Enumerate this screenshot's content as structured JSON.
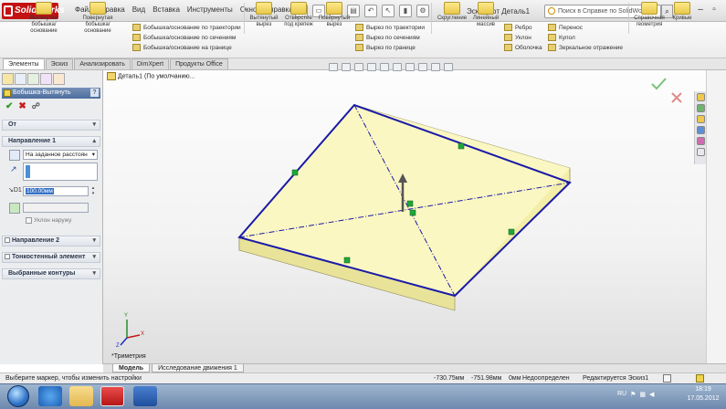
{
  "app": {
    "logo_text": "SolidWorks",
    "menu": [
      "Файл",
      "Правка",
      "Вид",
      "Вставка",
      "Инструменты",
      "Окно",
      "Справка"
    ],
    "doc_title": "Эскиз1 от Деталь1",
    "search_placeholder": "Поиск в Справке по SolidWorks"
  },
  "ribbon": {
    "large": [
      {
        "label": "Вытянутая бобышка/основание"
      },
      {
        "label": "Повернутая бобышка/основание"
      },
      {
        "label": "Вытянутый вырез"
      },
      {
        "label": "Отверстие под крепеж"
      },
      {
        "label": "Повернутый вырез"
      },
      {
        "label": "Скругление"
      },
      {
        "label": "Линейный массив"
      },
      {
        "label": "Справочная геометрия"
      },
      {
        "label": "Кривые"
      }
    ],
    "small_boss": [
      "Бобышка/основание по траектории",
      "Бобышка/основание по сечениям",
      "Бобышка/основание на границе"
    ],
    "small_cut": [
      "Вырез по траектории",
      "Вырез по сечениям",
      "Вырез по границе"
    ],
    "small_feat": [
      "Ребро",
      "Уклон",
      "Оболочка"
    ],
    "small_move": [
      "Перенос",
      "Купол",
      "Зеркальное отражение"
    ]
  },
  "tabs": [
    "Элементы",
    "Эскиз",
    "Анализировать",
    "DimXpert",
    "Продукты Office"
  ],
  "panel": {
    "feature_title": "Бобышка-Вытянуть",
    "help_icon": "?",
    "ok_symbol": "✔",
    "cancel_symbol": "✖",
    "from_label": "От",
    "direction1_label": "Направление 1",
    "end_condition": "На заданное расстоян",
    "depth_value": "100.00мм",
    "draft_outward": "Уклон наружу",
    "direction2_label": "Направление 2",
    "thin_feature_label": "Тонкостенный элемент",
    "selected_contours_label": "Выбранные контуры"
  },
  "graphics": {
    "tree_ref": "Деталь1 (По умолчанию...",
    "view_label": "*Триметрия",
    "triad": {
      "x": "X",
      "y": "Y",
      "z": "Z"
    },
    "model_fill": "#fbf7c2",
    "edge_color": "#1a1aa8"
  },
  "bottom_tabs": [
    "Модель",
    "Исследование движения 1"
  ],
  "status": {
    "hint": "Выберите маркер, чтобы изменить настройки",
    "x": "-730.75мм",
    "y": "-751.98мм",
    "z": "0мм",
    "state": "Недоопределен",
    "editing": "Редактируется Эскиз1"
  },
  "taskbar": {
    "lang": "RU",
    "time": "18:19",
    "date": "17.05.2012"
  }
}
